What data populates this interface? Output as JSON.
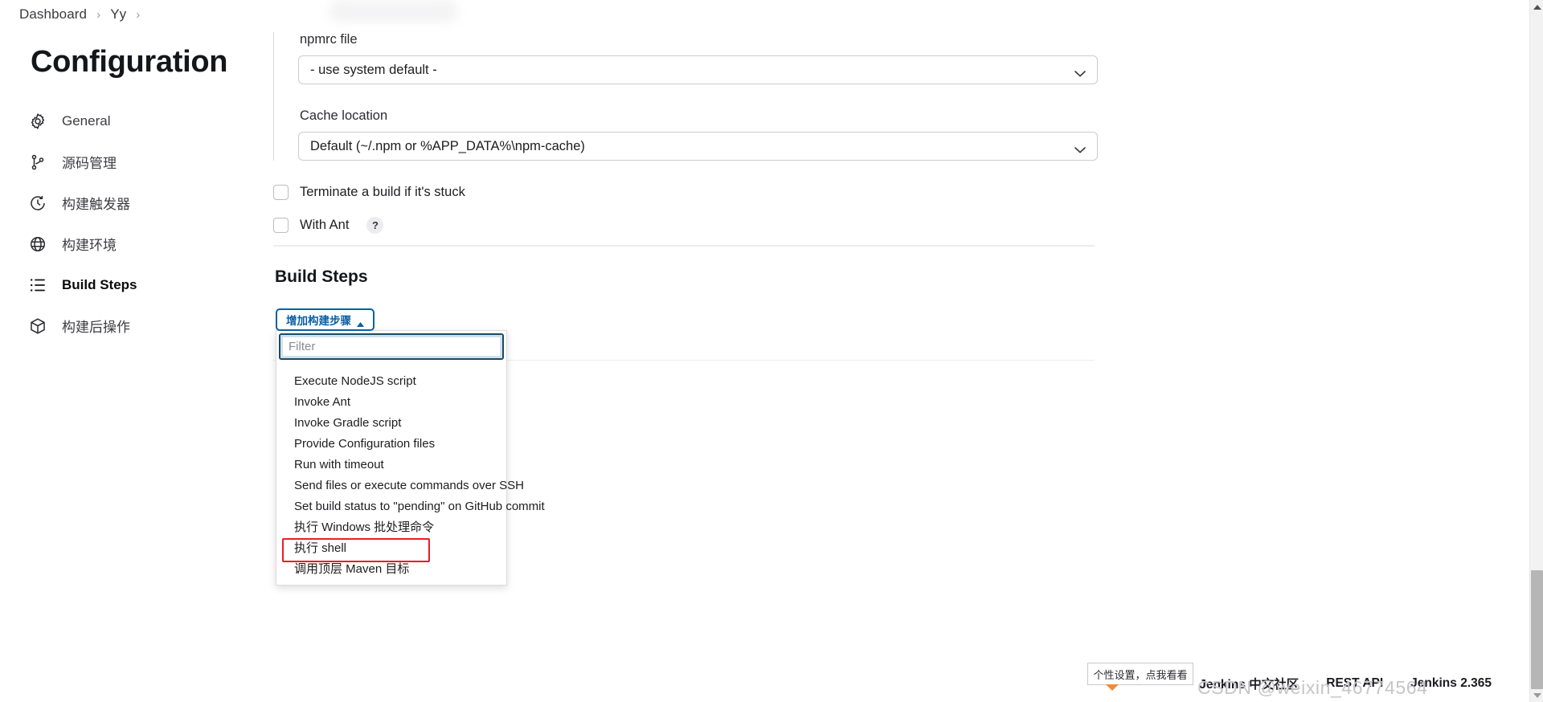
{
  "breadcrumb": {
    "items": [
      {
        "label": "Dashboard"
      },
      {
        "label": "Yy"
      }
    ],
    "separator": "›"
  },
  "sidebar": {
    "title": "Configuration",
    "items": [
      {
        "label": "General",
        "icon": "gear-icon",
        "active": false
      },
      {
        "label": "源码管理",
        "icon": "source-branch-icon",
        "active": false
      },
      {
        "label": "构建触发器",
        "icon": "clock-icon",
        "active": false
      },
      {
        "label": "构建环境",
        "icon": "globe-icon",
        "active": false
      },
      {
        "label": "Build Steps",
        "icon": "list-icon",
        "active": true
      },
      {
        "label": "构建后操作",
        "icon": "package-icon",
        "active": false
      }
    ]
  },
  "form": {
    "npmrc": {
      "label": "npmrc file",
      "value": "- use system default -"
    },
    "cache": {
      "label": "Cache location",
      "value": "Default (~/.npm or %APP_DATA%\\npm-cache)"
    },
    "checkboxes": [
      {
        "label": "Terminate a build if it's stuck",
        "checked": false,
        "help": false
      },
      {
        "label": "With Ant",
        "checked": false,
        "help": true,
        "help_glyph": "?"
      }
    ]
  },
  "build_steps": {
    "section_title": "Build Steps",
    "add_button_label": "增加构建步骤",
    "dropdown": {
      "filter_placeholder": "Filter",
      "filter_value": "",
      "items": [
        {
          "label": "Execute NodeJS script",
          "highlight": false
        },
        {
          "label": "Invoke Ant",
          "highlight": false
        },
        {
          "label": "Invoke Gradle script",
          "highlight": false
        },
        {
          "label": "Provide Configuration files",
          "highlight": false
        },
        {
          "label": "Run with timeout",
          "highlight": false
        },
        {
          "label": "Send files or execute commands over SSH",
          "highlight": false
        },
        {
          "label": "Set build status to \"pending\" on GitHub commit",
          "highlight": false
        },
        {
          "label": "执行 Windows 批处理命令",
          "highlight": false
        },
        {
          "label": "执行 shell",
          "highlight": true
        },
        {
          "label": "调用顶层 Maven 目标",
          "highlight": false
        }
      ]
    }
  },
  "footer": {
    "community": "Jenkins 中文社区",
    "rest_api": "REST API",
    "version": "Jenkins 2.365"
  },
  "overlay": {
    "tooltip": "个性设置，点我看看",
    "watermark": "CSDN @weixin_46774564"
  },
  "colors": {
    "accent_blue": "#0b5fa5",
    "highlight_red": "#ec1c24",
    "focus_teal": "#1b4a63"
  }
}
